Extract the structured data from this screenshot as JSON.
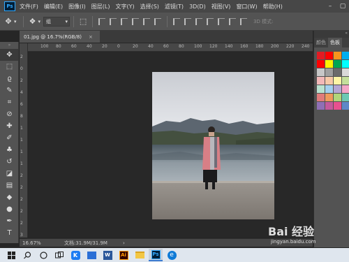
{
  "app": {
    "logo_text": "Ps"
  },
  "menu": [
    "文件(F)",
    "编辑(E)",
    "图像(I)",
    "图层(L)",
    "文字(Y)",
    "选择(S)",
    "滤镜(T)",
    "3D(D)",
    "视图(V)",
    "窗口(W)",
    "帮助(H)"
  ],
  "window_controls": {
    "minimize": "–",
    "maximize": "▢"
  },
  "options": {
    "group_select": "组",
    "mode_3d": "3D 模式:"
  },
  "document": {
    "tab_label": "01.jpg @ 16.7%(RGB/8)",
    "close": "×"
  },
  "ruler": {
    "top_ticks": [
      "100",
      "80",
      "60",
      "40",
      "20",
      "0",
      "20",
      "40",
      "60",
      "80",
      "100",
      "120",
      "140",
      "160",
      "180",
      "200",
      "220",
      "240",
      "260"
    ],
    "left_ticks": [
      "2",
      "0",
      "2",
      "4",
      "6",
      "8",
      "1",
      "1",
      "1",
      "1",
      "2",
      "2",
      "2",
      "2",
      "2",
      "3"
    ]
  },
  "status": {
    "zoom": "16.67%",
    "doc_info": "文档:31.9M/31.9M",
    "arrow": "›"
  },
  "panel": {
    "tabs": [
      "颜色",
      "色板"
    ],
    "swatches": [
      "#e31b23",
      "#ff0000",
      "#f7941d",
      "#00aeef",
      "#ff0000",
      "#fff200",
      "#00a651",
      "#00ffff",
      "#c7c7c7",
      "#9e9e9e",
      "#6b6b6b",
      "#d9d9d9",
      "#f2b8b8",
      "#f7c9a8",
      "#fff5a5",
      "#c4df9b",
      "#b9e2d0",
      "#a3d0ef",
      "#b5a6d3",
      "#f3a5c6",
      "#e07b7b",
      "#ee9a5d",
      "#b0d67a",
      "#6cc9b3",
      "#8f6fb5",
      "#c45a9c",
      "#e8508f",
      "#5d88c7"
    ]
  },
  "watermark": {
    "text": "Bai 经验",
    "url": "jingyan.baidu.com"
  }
}
